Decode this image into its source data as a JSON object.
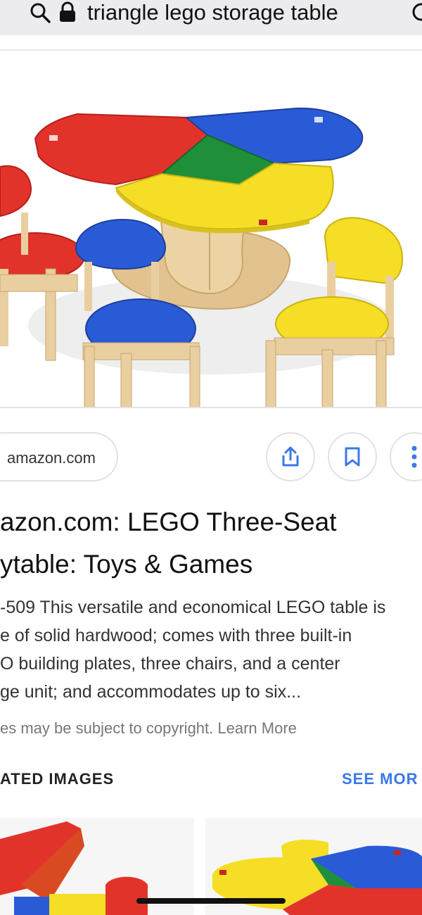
{
  "address_bar": {
    "query": "triangle lego storage table",
    "search_icon": "search-icon",
    "lock_icon": "lock-icon"
  },
  "result": {
    "source": "amazon.com",
    "title_lines": [
      "azon.com: LEGO Three-Seat",
      "ytable: Toys & Games"
    ],
    "description_lines": [
      "-509 This versatile and economical LEGO table is",
      "e of solid hardwood; comes with three built-in",
      "O building plates, three chairs, and a center",
      "ge unit; and accommodates up to six..."
    ],
    "copyright": "es may be subject to copyright. Learn More",
    "actions": [
      "share-icon",
      "bookmark-icon",
      "more-icon"
    ]
  },
  "related": {
    "heading": "ATED IMAGES",
    "see_more": "SEE MOR"
  },
  "colors": {
    "accent_blue": "#3b78e7",
    "lego_red": "#e2332b",
    "lego_blue": "#2a5bd7",
    "lego_yellow": "#f5de25",
    "lego_green": "#1f8f3a",
    "wood": "#e9cfa0"
  }
}
